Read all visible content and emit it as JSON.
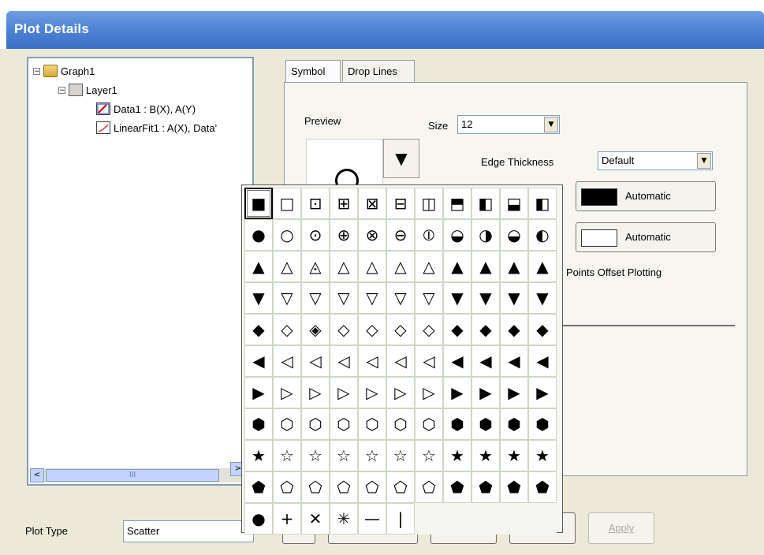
{
  "window": {
    "title": "Plot Details"
  },
  "tree": {
    "nodes": [
      {
        "label": "Graph1",
        "expander": "⊟",
        "icon": "folder-icon"
      },
      {
        "label": "Layer1",
        "expander": "⊟",
        "icon": "layer-icon"
      },
      {
        "label": "Data1 : B(X), A(Y)",
        "icon": "scatter-plot-icon"
      },
      {
        "label": "LinearFit1 : A(X), Data'",
        "icon": "line-plot-icon"
      }
    ],
    "scroll_left": "<",
    "scroll_right": ">",
    "scroll_grip": "III"
  },
  "tabs": [
    {
      "label": "Symbol",
      "selected": true
    },
    {
      "label": "Drop Lines",
      "selected": false
    }
  ],
  "symbol_tab": {
    "preview_label": "Preview",
    "preview_button_glyph": "▼",
    "size_label": "Size",
    "size_value": "12",
    "edge_thickness_label": "Edge Thickness",
    "edge_thickness_value": "Default",
    "edge_color_label": "Automatic",
    "edge_color": "#000000",
    "fill_color_label": "Automatic",
    "fill_color": "#ffffff",
    "points_offset_label": "Points Offset Plotting"
  },
  "combo_arrow_glyph": "▼",
  "bottom": {
    "plot_type_label": "Plot Type",
    "plot_type_value": "Scatter",
    "apply_label": "Apply"
  },
  "symbol_palette": {
    "rows": [
      [
        "■",
        "□",
        "⊡",
        "⊞",
        "⊠",
        "⊟",
        "◫",
        "⬒",
        "◧",
        "⬓",
        "◧"
      ],
      [
        "●",
        "○",
        "⊙",
        "⊕",
        "⊗",
        "⊖",
        "⦶",
        "◒",
        "◑",
        "◒",
        "◐"
      ],
      [
        "▲",
        "△",
        "◬",
        "△",
        "△",
        "△",
        "△",
        "▲",
        "▲",
        "▲",
        "▲"
      ],
      [
        "▼",
        "▽",
        "▽",
        "▽",
        "▽",
        "▽",
        "▽",
        "▼",
        "▼",
        "▼",
        "▼"
      ],
      [
        "◆",
        "◇",
        "◈",
        "◇",
        "◇",
        "◇",
        "◇",
        "◆",
        "◆",
        "◆",
        "◆"
      ],
      [
        "◀",
        "◁",
        "◁",
        "◁",
        "◁",
        "◁",
        "◁",
        "◀",
        "◀",
        "◀",
        "◀"
      ],
      [
        "▶",
        "▷",
        "▷",
        "▷",
        "▷",
        "▷",
        "▷",
        "▶",
        "▶",
        "▶",
        "▶"
      ],
      [
        "⬢",
        "⬡",
        "⬡",
        "⬡",
        "⬡",
        "⬡",
        "⬡",
        "⬢",
        "⬢",
        "⬢",
        "⬢"
      ],
      [
        "★",
        "☆",
        "☆",
        "☆",
        "☆",
        "☆",
        "☆",
        "★",
        "★",
        "★",
        "★"
      ],
      [
        "⬟",
        "⬠",
        "⬠",
        "⬠",
        "⬠",
        "⬠",
        "⬠",
        "⬟",
        "⬟",
        "⬟",
        "⬟"
      ],
      [
        "●",
        "+",
        "✕",
        "✳",
        "—",
        "|",
        "",
        "",
        "",
        "",
        ""
      ]
    ]
  }
}
